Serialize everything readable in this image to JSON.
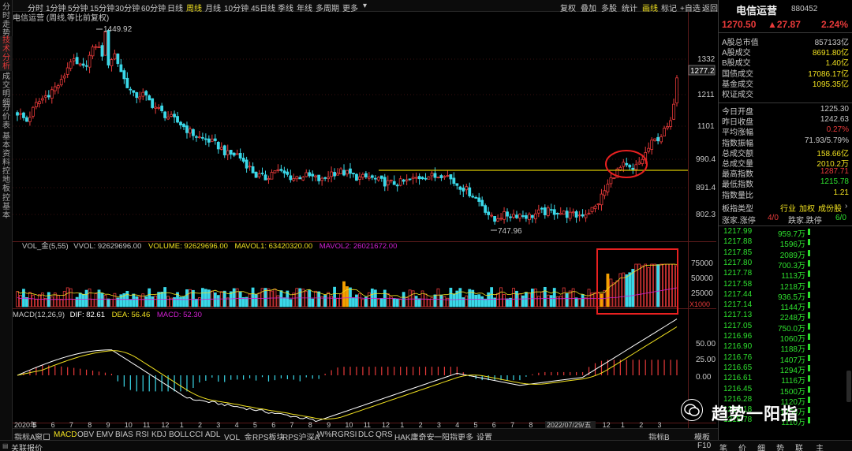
{
  "left_tabs": [
    {
      "label": "分时走势",
      "active": false
    },
    {
      "label": "技术分析",
      "active": true
    },
    {
      "label": "成交明细",
      "active": false
    },
    {
      "label": "分价表",
      "active": false
    },
    {
      "label": "基本资料",
      "active": false
    },
    {
      "label": "控地板",
      "active": false
    },
    {
      "label": "控基本",
      "active": false
    }
  ],
  "toolbar": {
    "periods": [
      "分时",
      "1分钟",
      "5分钟",
      "15分钟",
      "30分钟",
      "60分钟",
      "日线",
      "周线",
      "月线",
      "10分钟",
      "45日线",
      "季线",
      "年线",
      "多周期",
      "更多"
    ],
    "active_period": "周线",
    "right_items": [
      "复权",
      "叠加",
      "多股",
      "统计",
      "画线",
      "标记",
      "+自选",
      "返回"
    ],
    "active_right": "画线"
  },
  "main_chart": {
    "title": "电信运营 (周线,等比前复权)",
    "price_axis": [
      "1332",
      "1211",
      "1101",
      "990.4",
      "891.4",
      "802.3"
    ],
    "current_price_tag": "1277.2",
    "high_label": "1449.92",
    "low_label": "747.96"
  },
  "volume_chart": {
    "header": {
      "name": "VOL_金(5,55)",
      "vvol": "VVOL: 92629696.00",
      "volume": "VOLUME: 92629696.00",
      "mavol1": "MAVOL1: 63420320.00",
      "mavol2": "MAVOL2: 26021672.00"
    },
    "axis": [
      "75000",
      "50000",
      "25000"
    ],
    "unit": "X1000"
  },
  "macd_chart": {
    "header": {
      "name": "MACD(12,26,9)",
      "dif": "DIF: 82.61",
      "dea": "DEA: 56.46",
      "macd": "MACD: 52.30"
    },
    "axis": [
      "50.00",
      "25.00",
      "0.00"
    ]
  },
  "date_axis": {
    "labels": [
      "2020年",
      "5",
      "6",
      "7",
      "8",
      "9",
      "10",
      "11",
      "12",
      "1",
      "2",
      "3",
      "4",
      "5",
      "6",
      "7",
      "8",
      "9",
      "10",
      "11",
      "12",
      "1",
      "2",
      "3",
      "4",
      "5",
      "6",
      "7",
      "8",
      "9",
      "10",
      "11",
      "12",
      "1",
      "2",
      "3"
    ],
    "cursor_date": "2022/07/29/五"
  },
  "right_panel": {
    "name": "电信运营",
    "code": "880452",
    "price": "1270.50",
    "change": "▲27.87",
    "change_pct": "2.24%",
    "fields1": [
      {
        "label": "A股总市值",
        "value": "857133亿",
        "color": "#c8c8c8"
      },
      {
        "label": "A股成交",
        "value": "8691.80亿",
        "color": "#f0e020"
      },
      {
        "label": "B股成交",
        "value": "1.40亿",
        "color": "#f0e020"
      },
      {
        "label": "国债成交",
        "value": "17086.17亿",
        "color": "#f0e020"
      },
      {
        "label": "基金成交",
        "value": "1095.35亿",
        "color": "#f0e020"
      },
      {
        "label": "权证成交",
        "value": "",
        "color": "#f0e020"
      }
    ],
    "fields2": [
      {
        "label": "今日开盘",
        "value": "1225.30",
        "color": "#c8c8c8"
      },
      {
        "label": "昨日收盘",
        "value": "1242.63",
        "color": "#c8c8c8"
      },
      {
        "label": "平均涨幅",
        "value": "0.27%",
        "color": "#e83a3a"
      },
      {
        "label": "指数振幅",
        "value": "71.93/5.79%",
        "color": "#c8c8c8"
      },
      {
        "label": "总成交额",
        "value": "158.66亿",
        "color": "#f0e020"
      },
      {
        "label": "总成交量",
        "value": "2010.2万",
        "color": "#f0e020"
      },
      {
        "label": "最高指数",
        "value": "1287.71",
        "color": "#e83a3a"
      },
      {
        "label": "最低指数",
        "value": "1215.78",
        "color": "#2ee02e"
      },
      {
        "label": "指数量比",
        "value": "1.21",
        "color": "#f0e020"
      }
    ],
    "board_type": {
      "label": "板指类型",
      "items": [
        "行业",
        "加权",
        "成份股"
      ]
    },
    "stats": {
      "up_label": "涨家.涨停",
      "up_value": "4/0",
      "down_label": "跌家.跌停",
      "down_value": "6/0"
    },
    "orders": [
      {
        "price": "1217.99",
        "qty": "959.7万"
      },
      {
        "price": "1217.88",
        "qty": "1596万"
      },
      {
        "price": "1217.85",
        "qty": "2089万"
      },
      {
        "price": "1217.80",
        "qty": "700.3万"
      },
      {
        "price": "1217.78",
        "qty": "1113万"
      },
      {
        "price": "1217.58",
        "qty": "1218万"
      },
      {
        "price": "1217.44",
        "qty": "936.5万"
      },
      {
        "price": "1217.14",
        "qty": "1144万"
      },
      {
        "price": "1217.13",
        "qty": "2248万"
      },
      {
        "price": "1217.05",
        "qty": "750.0万"
      },
      {
        "price": "1216.96",
        "qty": "1060万"
      },
      {
        "price": "1216.90",
        "qty": "1188万"
      },
      {
        "price": "1216.76",
        "qty": "1407万"
      },
      {
        "price": "1216.65",
        "qty": "1294万"
      },
      {
        "price": "1216.61",
        "qty": "1116万"
      },
      {
        "price": "1216.45",
        "qty": "1500万"
      },
      {
        "price": "1216.28",
        "qty": "1120万"
      },
      {
        "price": "1216.18",
        "qty": "1250万"
      },
      {
        "price": "1215.78",
        "qty": "1110万"
      }
    ]
  },
  "bottom_bar": {
    "items": [
      "指标A",
      "窗口",
      "MACD",
      "OBV",
      "EMV",
      "BIAS",
      "RSI",
      "KDJ",
      "BOLL",
      "CCI",
      "ADL",
      "VOL_金",
      "RPS板块",
      "RPS沪深A",
      "W%R",
      "GRSI",
      "DLC",
      "QRS",
      "HAK庸奇安",
      "一阳指",
      "更多",
      "设置"
    ],
    "active": "MACD",
    "right_items": [
      "指标B",
      "模板"
    ]
  },
  "status_bar": {
    "label": "关联报价",
    "f10": "F10",
    "buttons": [
      "笔",
      "价",
      "细",
      "势",
      "联",
      "主"
    ]
  },
  "watermark": {
    "text": "趋势一阳指"
  }
}
